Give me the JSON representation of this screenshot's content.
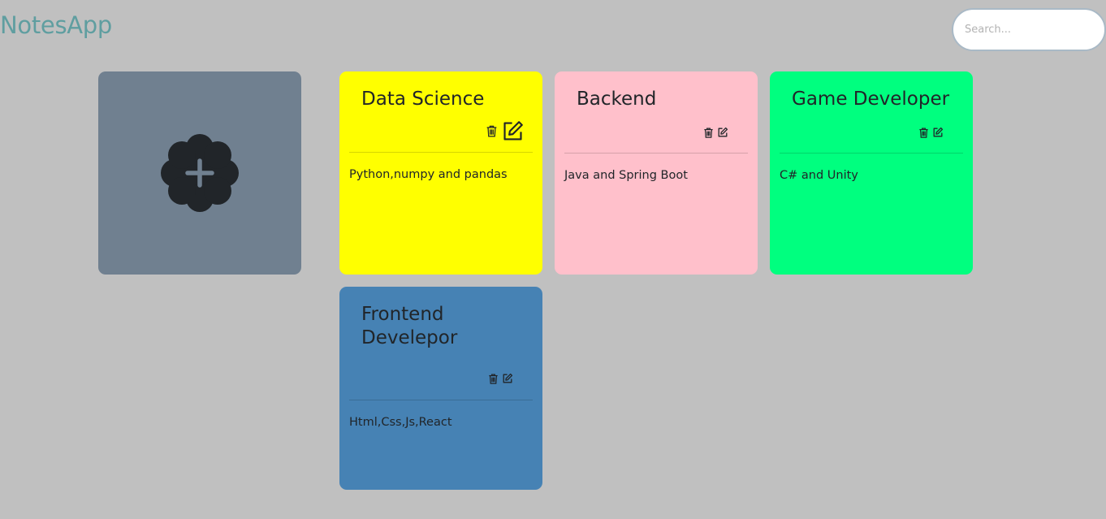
{
  "header": {
    "app_title": "NotesApp",
    "search_placeholder": "Search...",
    "search_value": ""
  },
  "add_tile": {
    "icon": "plus-badge-icon",
    "color": "#708090",
    "icon_color": "#212529"
  },
  "notes": [
    {
      "title": "Data Science",
      "body": "Python,numpy and pandas",
      "color": "#ffff00",
      "actions": [
        "trash-icon",
        "edit-icon"
      ]
    },
    {
      "title": "Backend",
      "body": "Java and Spring Boot",
      "color": "#ffc0cb",
      "actions": [
        "trash-icon",
        "edit-icon"
      ]
    },
    {
      "title": "Game Developer",
      "body": "C# and Unity",
      "color": "#00ff7f",
      "actions": [
        "trash-icon",
        "edit-icon"
      ]
    },
    {
      "title": "Frontend Develepor",
      "body": "Html,Css,Js,React",
      "color": "#4682b4",
      "actions": [
        "trash-icon",
        "edit-icon"
      ]
    }
  ],
  "colors": {
    "page_background": "#c0c0c0",
    "brand_title": "#5f9ea0"
  }
}
